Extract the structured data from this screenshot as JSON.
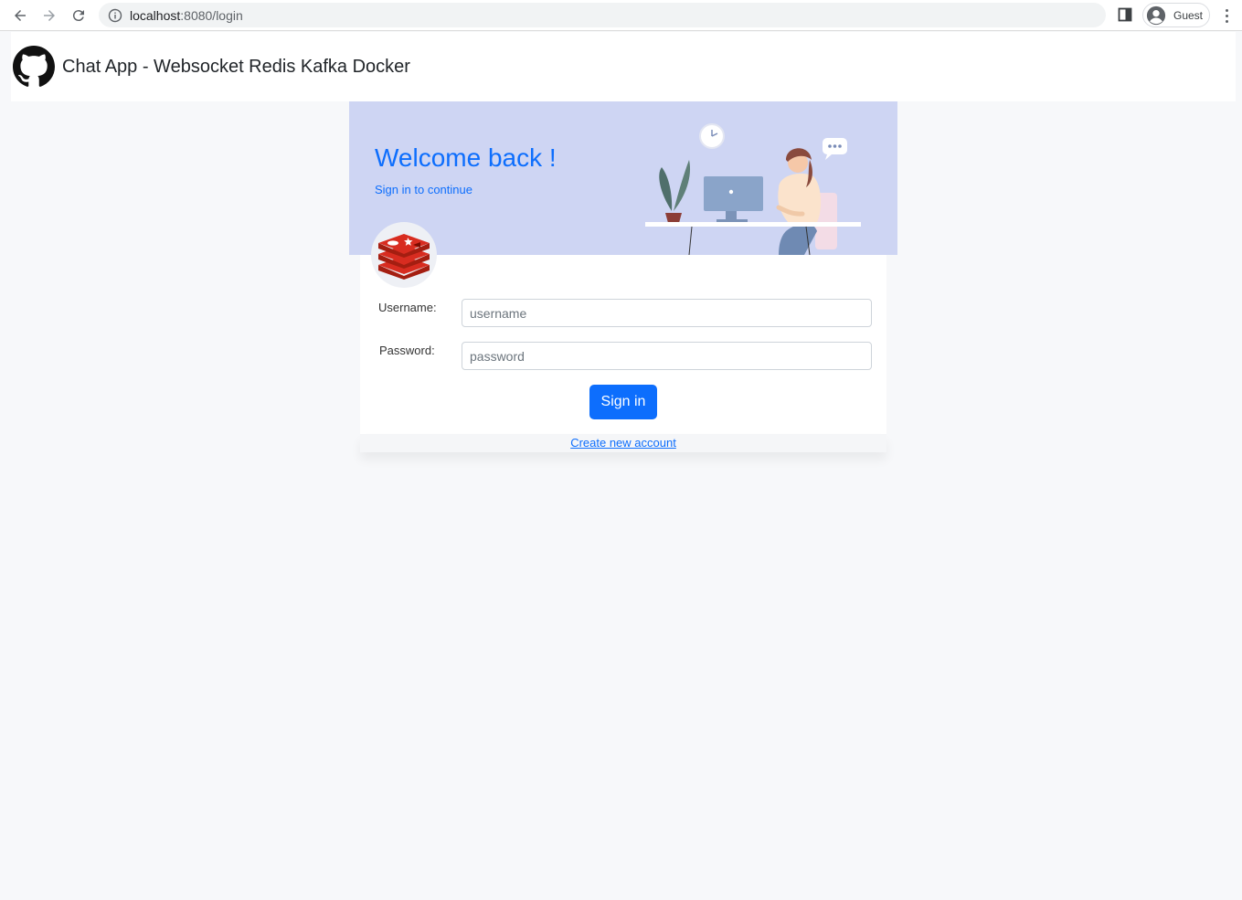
{
  "browser": {
    "url_host": "localhost",
    "url_path": ":8080/login",
    "profile_label": "Guest"
  },
  "header": {
    "title": "Chat App - Websocket Redis Kafka Docker"
  },
  "banner": {
    "welcome": "Welcome back !",
    "subtitle": "Sign in to continue"
  },
  "form": {
    "username_label": "Username:",
    "username_placeholder": "username",
    "username_value": "",
    "password_label": "Password:",
    "password_placeholder": "password",
    "password_value": "",
    "submit_label": "Sign in"
  },
  "footer": {
    "create_account_link": "Create new account"
  },
  "colors": {
    "accent": "#0d6efd",
    "banner_bg": "#ced5f3",
    "page_bg": "#f7f8fa",
    "redis_red": "#c6302b"
  },
  "icons": {
    "back": "arrow-left-icon",
    "forward": "arrow-right-icon",
    "reload": "reload-icon",
    "site_info": "info-icon",
    "side_panel": "side-panel-icon",
    "profile": "account-circle-icon",
    "menu": "vertical-dots-icon",
    "logo": "github-icon",
    "badge": "redis-icon"
  }
}
